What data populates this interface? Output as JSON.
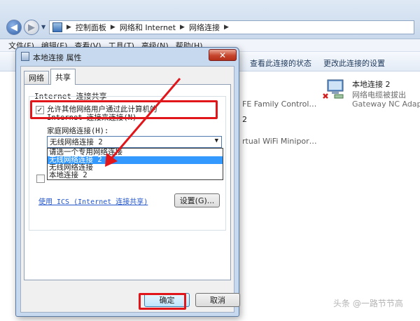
{
  "breadcrumb": [
    "控制面板",
    "网络和 Internet",
    "网络连接"
  ],
  "menu": [
    "文件(F)",
    "编辑(E)",
    "查看(V)",
    "工具(T)",
    "高级(N)",
    "帮助(H)"
  ],
  "toolbar": [
    "查看此连接的状态",
    "更改此连接的设置"
  ],
  "adapters": {
    "connection2": {
      "name": "本地连接 2",
      "status": "网络电缆被拔出",
      "device": "Gateway NC Adapt"
    },
    "family_fragment": "FE Family Control…",
    "wifi_fragment": "rtual WiFi Minipor…",
    "number_fragment": "2"
  },
  "dialog": {
    "title": "本地连接 属性",
    "close": "✕",
    "tabs": [
      "网络",
      "共享"
    ],
    "group_title": "Internet 连接共享",
    "allow_text": "允许其他网络用户通过此计算机的 Internet 连接来连接(N)",
    "home_label": "家庭网络连接(H):",
    "select_value": "无线网络连接 2",
    "options": [
      "请选一个专用网络连接",
      "无线网络连接 2",
      "无线网络连接",
      "本地连接 2"
    ],
    "link": "使用 ICS (Internet 连接共享)",
    "settings": "设置(G)...",
    "ok": "确定",
    "cancel": "取消"
  },
  "watermark": "头条 @一路节节高",
  "colors": {
    "highlight": "#e0161b",
    "selected": "#3399ff"
  }
}
